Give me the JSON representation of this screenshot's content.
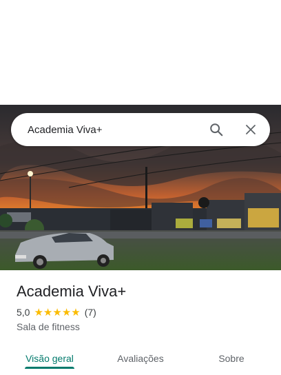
{
  "search": {
    "query": "Academia Viva+",
    "search_icon": "search-icon",
    "close_icon": "close-icon"
  },
  "photo": {
    "description_icon": "place-photo"
  },
  "place": {
    "title": "Academia Viva+",
    "rating": "5,0",
    "stars": 5,
    "review_count": "(7)",
    "category": "Sala de fitness"
  },
  "tabs": [
    {
      "label": "Visão geral",
      "active": true
    },
    {
      "label": "Avaliações",
      "active": false
    },
    {
      "label": "Sobre",
      "active": false
    }
  ],
  "colors": {
    "accent": "#00796b",
    "star": "#fbbc04"
  }
}
